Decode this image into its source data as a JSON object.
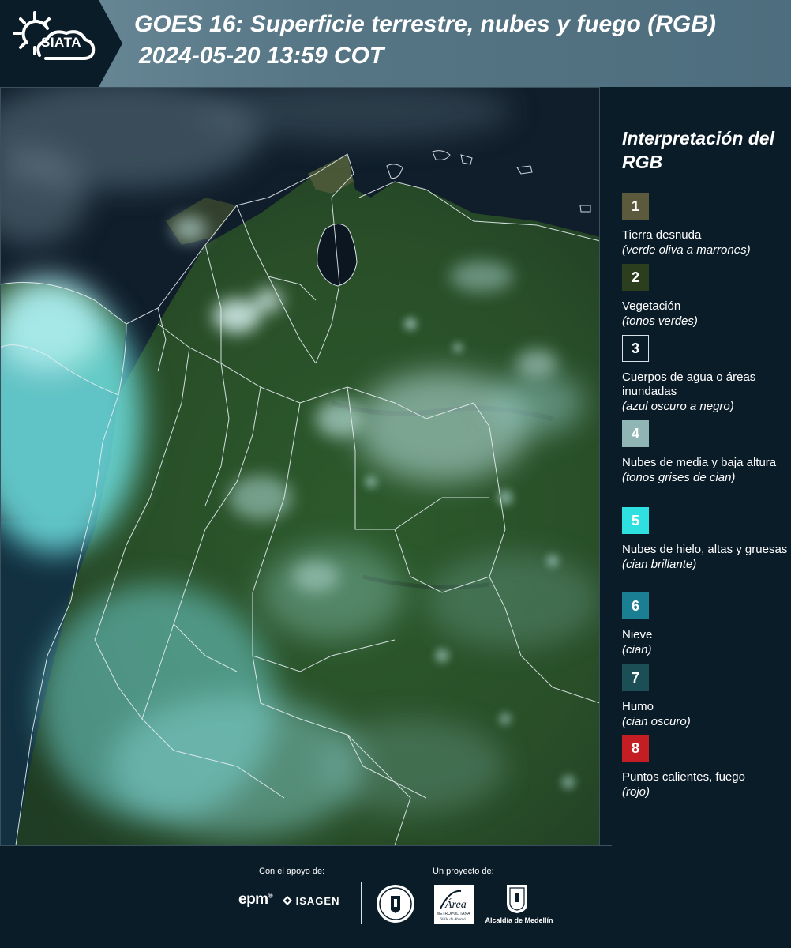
{
  "header": {
    "logo_text": "SIATA",
    "title_line1": "GOES 16: Superficie terrestre, nubes y fuego (RGB)",
    "title_line2": "2024-05-20 13:59 COT"
  },
  "legend": {
    "title": "Interpretación del RGB",
    "items": [
      {
        "number": "1",
        "label": "Tierra desnuda",
        "note": "(verde oliva a marrones)",
        "color": "#5b5a3c"
      },
      {
        "number": "2",
        "label": "Vegetación",
        "note": "(tonos verdes)",
        "color": "#2b3f1f"
      },
      {
        "number": "3",
        "label": "Cuerpos de agua o áreas inundadas",
        "note": "(azul oscuro a negro)",
        "color": "#0b1c29"
      },
      {
        "number": "4",
        "label": "Nubes de media y baja altura",
        "note": "(tonos grises de cian)",
        "color": "#8fb5b5"
      },
      {
        "number": "5",
        "label": "Nubes de hielo, altas y gruesas",
        "note": "(cian brillante)",
        "color": "#2fe0e0"
      },
      {
        "number": "6",
        "label": "Nieve",
        "note": "(cian)",
        "color": "#1b7f93"
      },
      {
        "number": "7",
        "label": "Humo",
        "note": "(cian oscuro)",
        "color": "#1c4e56"
      },
      {
        "number": "8",
        "label": "Puntos calientes, fuego",
        "note": "(rojo)",
        "color": "#c41e24"
      }
    ]
  },
  "footer": {
    "support_label": "Con el apoyo de:",
    "project_label": "Un proyecto de:",
    "epm": "epm",
    "isagen": "ISAGEN",
    "area_name": "Área",
    "area_sub1": "METROPOLITANA",
    "area_sub2": "Valle de Aburrá",
    "medellin": "Alcaldía de Medellín"
  }
}
